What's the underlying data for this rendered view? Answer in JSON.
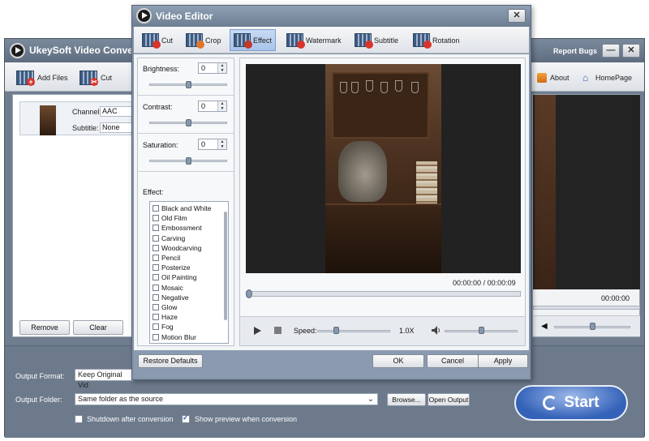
{
  "app": {
    "title": "UkeySoft Video Conve",
    "report_bugs": "Report Bugs",
    "minimize": "—",
    "close": "✕",
    "toolbar": {
      "add_files": "Add Files",
      "cut": "Cut",
      "about": "About",
      "homepage": "HomePage"
    },
    "file_list": {
      "channel_label": "Channel:",
      "channel_value": "AAC",
      "subtitle_label": "Subtitle:",
      "subtitle_value": "None",
      "remove": "Remove",
      "clear": "Clear"
    },
    "preview": {
      "time": "00:00:00"
    },
    "bottom": {
      "output_format_label": "Output Format:",
      "output_format_value": "Keep Original Vid",
      "output_folder_label": "Output Folder:",
      "output_folder_value": "Same folder as the source",
      "browse": "Browse...",
      "open_output": "Open Output",
      "shutdown_label": "Shutdown after conversion",
      "shutdown_checked": false,
      "preview_label": "Show preview when conversion",
      "preview_checked": true,
      "start": "Start"
    }
  },
  "dialog": {
    "title": "Video Editor",
    "close": "✕",
    "tabs": [
      {
        "label": "Cut",
        "active": false,
        "badge_color": "#d9342b"
      },
      {
        "label": "Crop",
        "active": false,
        "badge_color": "#e2752c"
      },
      {
        "label": "Effect",
        "active": true,
        "badge_color": "#c0392b"
      },
      {
        "label": "Watermark",
        "active": false,
        "badge_color": "#d9342b"
      },
      {
        "label": "Subtitle",
        "active": false,
        "badge_color": "#d9342b"
      },
      {
        "label": "Rotation",
        "active": false,
        "badge_color": "#d9342b"
      }
    ],
    "adjustments": [
      {
        "label": "Brightness:",
        "value": "0",
        "level": 0.5
      },
      {
        "label": "Contrast:",
        "value": "0",
        "level": 0.5
      },
      {
        "label": "Saturation:",
        "value": "0",
        "level": 0.5
      }
    ],
    "effect_label": "Effect:",
    "effects": [
      "Black and White",
      "Old Film",
      "Embossment",
      "Carving",
      "Woodcarving",
      "Pencil",
      "Posterize",
      "Oil Painting",
      "Mosaic",
      "Negative",
      "Glow",
      "Haze",
      "Fog",
      "Motion Blur"
    ],
    "player": {
      "current_time": "00:00:00",
      "separator": "/",
      "duration": "00:00:09",
      "progress": 0,
      "speed_label": "Speed:",
      "speed_value": "1.0X",
      "speed_level": 0.25,
      "volume_level": 0.5
    },
    "footer": {
      "restore_defaults": "Restore Defaults",
      "ok": "OK",
      "cancel": "Cancel",
      "apply": "Apply"
    }
  }
}
